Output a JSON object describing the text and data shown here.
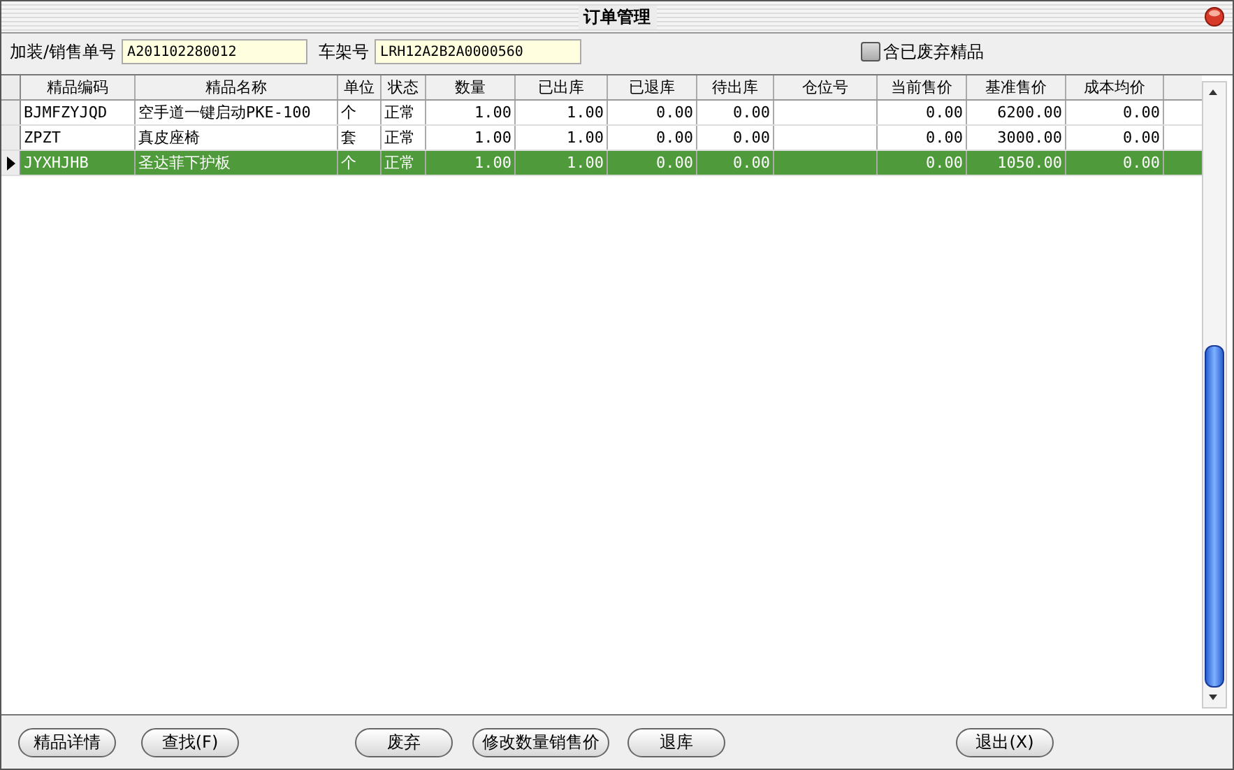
{
  "window": {
    "title": "订单管理"
  },
  "filters": {
    "order_label": "加装/销售单号",
    "order_value": "A201102280012",
    "frame_label": "车架号",
    "frame_value": "LRH12A2B2A0000560",
    "include_discarded": {
      "label": "含已废弃精品",
      "checked": false
    }
  },
  "table": {
    "columns": [
      "精品编码",
      "精品名称",
      "单位",
      "状态",
      "数量",
      "已出库",
      "已退库",
      "待出库",
      "仓位号",
      "当前售价",
      "基准售价",
      "成本均价"
    ],
    "rows": [
      {
        "cells": [
          "BJMFZYJQD",
          "空手道一键启动PKE-100",
          "个",
          "正常",
          "1.00",
          "1.00",
          "0.00",
          "0.00",
          "",
          "0.00",
          "6200.00",
          "0.00"
        ],
        "selected": false
      },
      {
        "cells": [
          "ZPZT",
          "真皮座椅",
          "套",
          "正常",
          "1.00",
          "1.00",
          "0.00",
          "0.00",
          "",
          "0.00",
          "3000.00",
          "0.00"
        ],
        "selected": false
      },
      {
        "cells": [
          "JYXHJHB",
          "圣达菲下护板",
          "个",
          "正常",
          "1.00",
          "1.00",
          "0.00",
          "0.00",
          "",
          "0.00",
          "1050.00",
          "0.00"
        ],
        "selected": true
      }
    ]
  },
  "buttons": [
    "精品详情",
    "查找(F)",
    "废弃",
    "修改数量销售价",
    "退库",
    "退出(X)"
  ]
}
